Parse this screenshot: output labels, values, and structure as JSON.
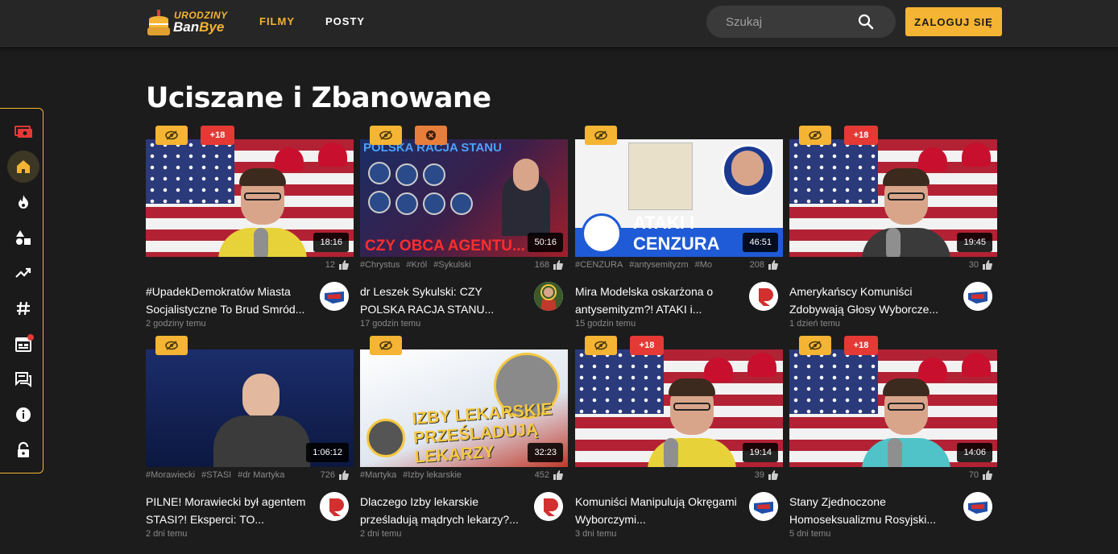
{
  "header": {
    "logo_top": "URODZINY",
    "logo_brand_1": "Ban",
    "logo_brand_2": "Bye",
    "nav": [
      "FILMY",
      "POSTY"
    ],
    "search_placeholder": "Szukaj",
    "login_label": "ZALOGUJ SIĘ"
  },
  "colors": {
    "accent": "#f5b433",
    "badge_18": "#e53935",
    "background": "#1c1c1c"
  },
  "sidebar": {
    "items": [
      {
        "icon": "money-icon"
      },
      {
        "icon": "home-icon",
        "active": true
      },
      {
        "icon": "fire-icon"
      },
      {
        "icon": "categories-icon"
      },
      {
        "icon": "trending-icon"
      },
      {
        "icon": "hashtag-icon"
      },
      {
        "icon": "calendar-icon",
        "notification": true
      },
      {
        "icon": "comments-icon"
      },
      {
        "icon": "info-icon"
      },
      {
        "icon": "lock-icon"
      }
    ]
  },
  "page": {
    "title": "Uciszane i Zbanowane"
  },
  "videos": [
    {
      "title": "#UpadekDemokratów Miasta Socjalistyczne To Brud Smród...",
      "duration": "18:16",
      "likes": "12",
      "tags": [],
      "time": "2 godziny temu",
      "badge_18": "+18"
    },
    {
      "title": "dr Leszek Sykulski: CZY POLSKA RACJA STANU...",
      "duration": "50:16",
      "likes": "168",
      "tags": [
        "#Chrystus",
        "#Król",
        "#Sykulski"
      ],
      "time": "17 godzin temu",
      "thumb_header": "POLSKA RACJA STANU",
      "thumb_footer": "CZY OBCA AGENTU..."
    },
    {
      "title": "Mira Modelska oskarżona o antysemityzm?! ATAKI i...",
      "duration": "46:51",
      "likes": "208",
      "tags": [
        "#CENZURA",
        "#antysemityzm",
        "#Mo"
      ],
      "time": "15 godzin temu",
      "thumb_text": "ATAKI I CENZURA"
    },
    {
      "title": "Amerykańscy Komuniści Zdobywają Głosy Wyborcze...",
      "duration": "19:45",
      "likes": "30",
      "tags": [],
      "time": "1 dzień temu",
      "badge_18": "+18"
    },
    {
      "title": "PILNE! Morawiecki był agentem STASI?! Eksperci: TO...",
      "duration": "1:06:12",
      "likes": "726",
      "tags": [
        "#Morawiecki",
        "#STASI",
        "#dr Martyka"
      ],
      "time": "2 dni temu"
    },
    {
      "title": "Dlaczego Izby lekarskie prześladują mądrych lekarzy?...",
      "duration": "32:23",
      "likes": "452",
      "tags": [
        "#Martyka",
        "#Izby lekarskie"
      ],
      "time": "2 dni temu",
      "thumb_text": "IZBY LEKARSKIE PRZEŚLADUJĄ LEKARZY"
    },
    {
      "title": "Komuniści Manipulują Okręgami Wyborczymi...",
      "duration": "19:14",
      "likes": "39",
      "tags": [],
      "time": "3 dni temu",
      "badge_18": "+18"
    },
    {
      "title": "Stany Zjednoczone Homoseksualizmu Rosyjski...",
      "duration": "14:06",
      "likes": "70",
      "tags": [],
      "time": "5 dni temu",
      "badge_18": "+18"
    }
  ]
}
